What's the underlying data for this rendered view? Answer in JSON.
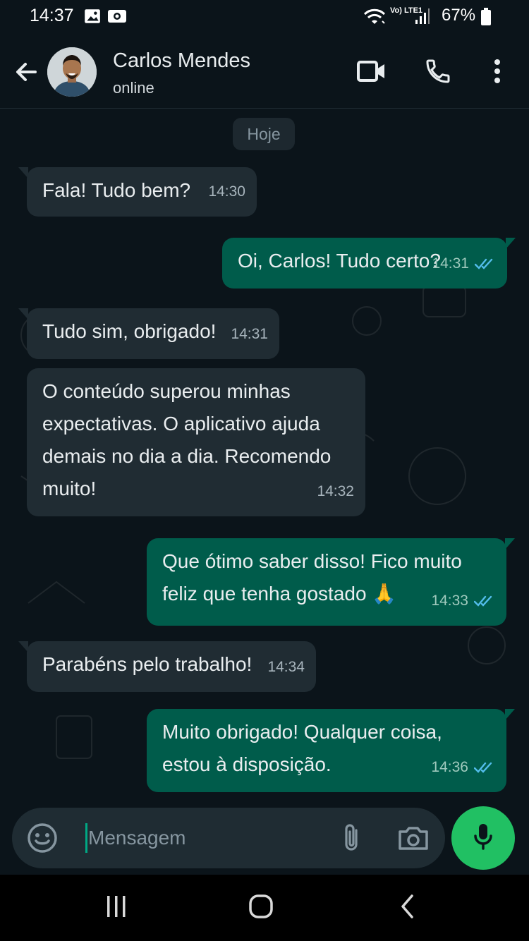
{
  "status_bar": {
    "time": "14:37",
    "battery": "67%",
    "network_label": "Vo) LTE1",
    "icons": [
      "gallery-icon",
      "screen-record-icon",
      "wifi-icon",
      "volte-icon",
      "signal-icon",
      "battery-icon"
    ]
  },
  "header": {
    "contact_name": "Carlos Mendes",
    "contact_status": "online",
    "icons": [
      "back-arrow-icon",
      "video-call-icon",
      "voice-call-icon",
      "more-options-icon"
    ]
  },
  "chat": {
    "date_chip": "Hoje",
    "messages": [
      {
        "direction": "in",
        "text": "Fala! Tudo bem?",
        "time": "14:30"
      },
      {
        "direction": "out",
        "text": "Oi, Carlos! Tudo certo?",
        "time": "14:31",
        "status": "read"
      },
      {
        "direction": "in",
        "text": "Tudo sim, obrigado!",
        "time": "14:31"
      },
      {
        "direction": "in",
        "text": "O conteúdo superou minhas expectativas. O aplicativo ajuda demais no dia a dia. Recomendo muito!",
        "time": "14:32"
      },
      {
        "direction": "out",
        "text": "Que ótimo saber disso! Fico muito feliz que tenha gostado 🙏",
        "time": "14:33",
        "status": "read"
      },
      {
        "direction": "in",
        "text": "Parabéns pelo trabalho!",
        "time": "14:34"
      },
      {
        "direction": "out",
        "text": "Muito obrigado! Qualquer coisa, estou à disposição.",
        "time": "14:36",
        "status": "read"
      }
    ]
  },
  "composer": {
    "placeholder": "Mensagem",
    "value": "",
    "icons": [
      "emoji-icon",
      "attach-icon",
      "camera-icon",
      "microphone-icon"
    ]
  },
  "colors": {
    "background": "#0b141a",
    "incoming_bubble": "#202c33",
    "outgoing_bubble": "#005c4b",
    "accent": "#21c063",
    "read_ticks": "#53bdeb"
  }
}
